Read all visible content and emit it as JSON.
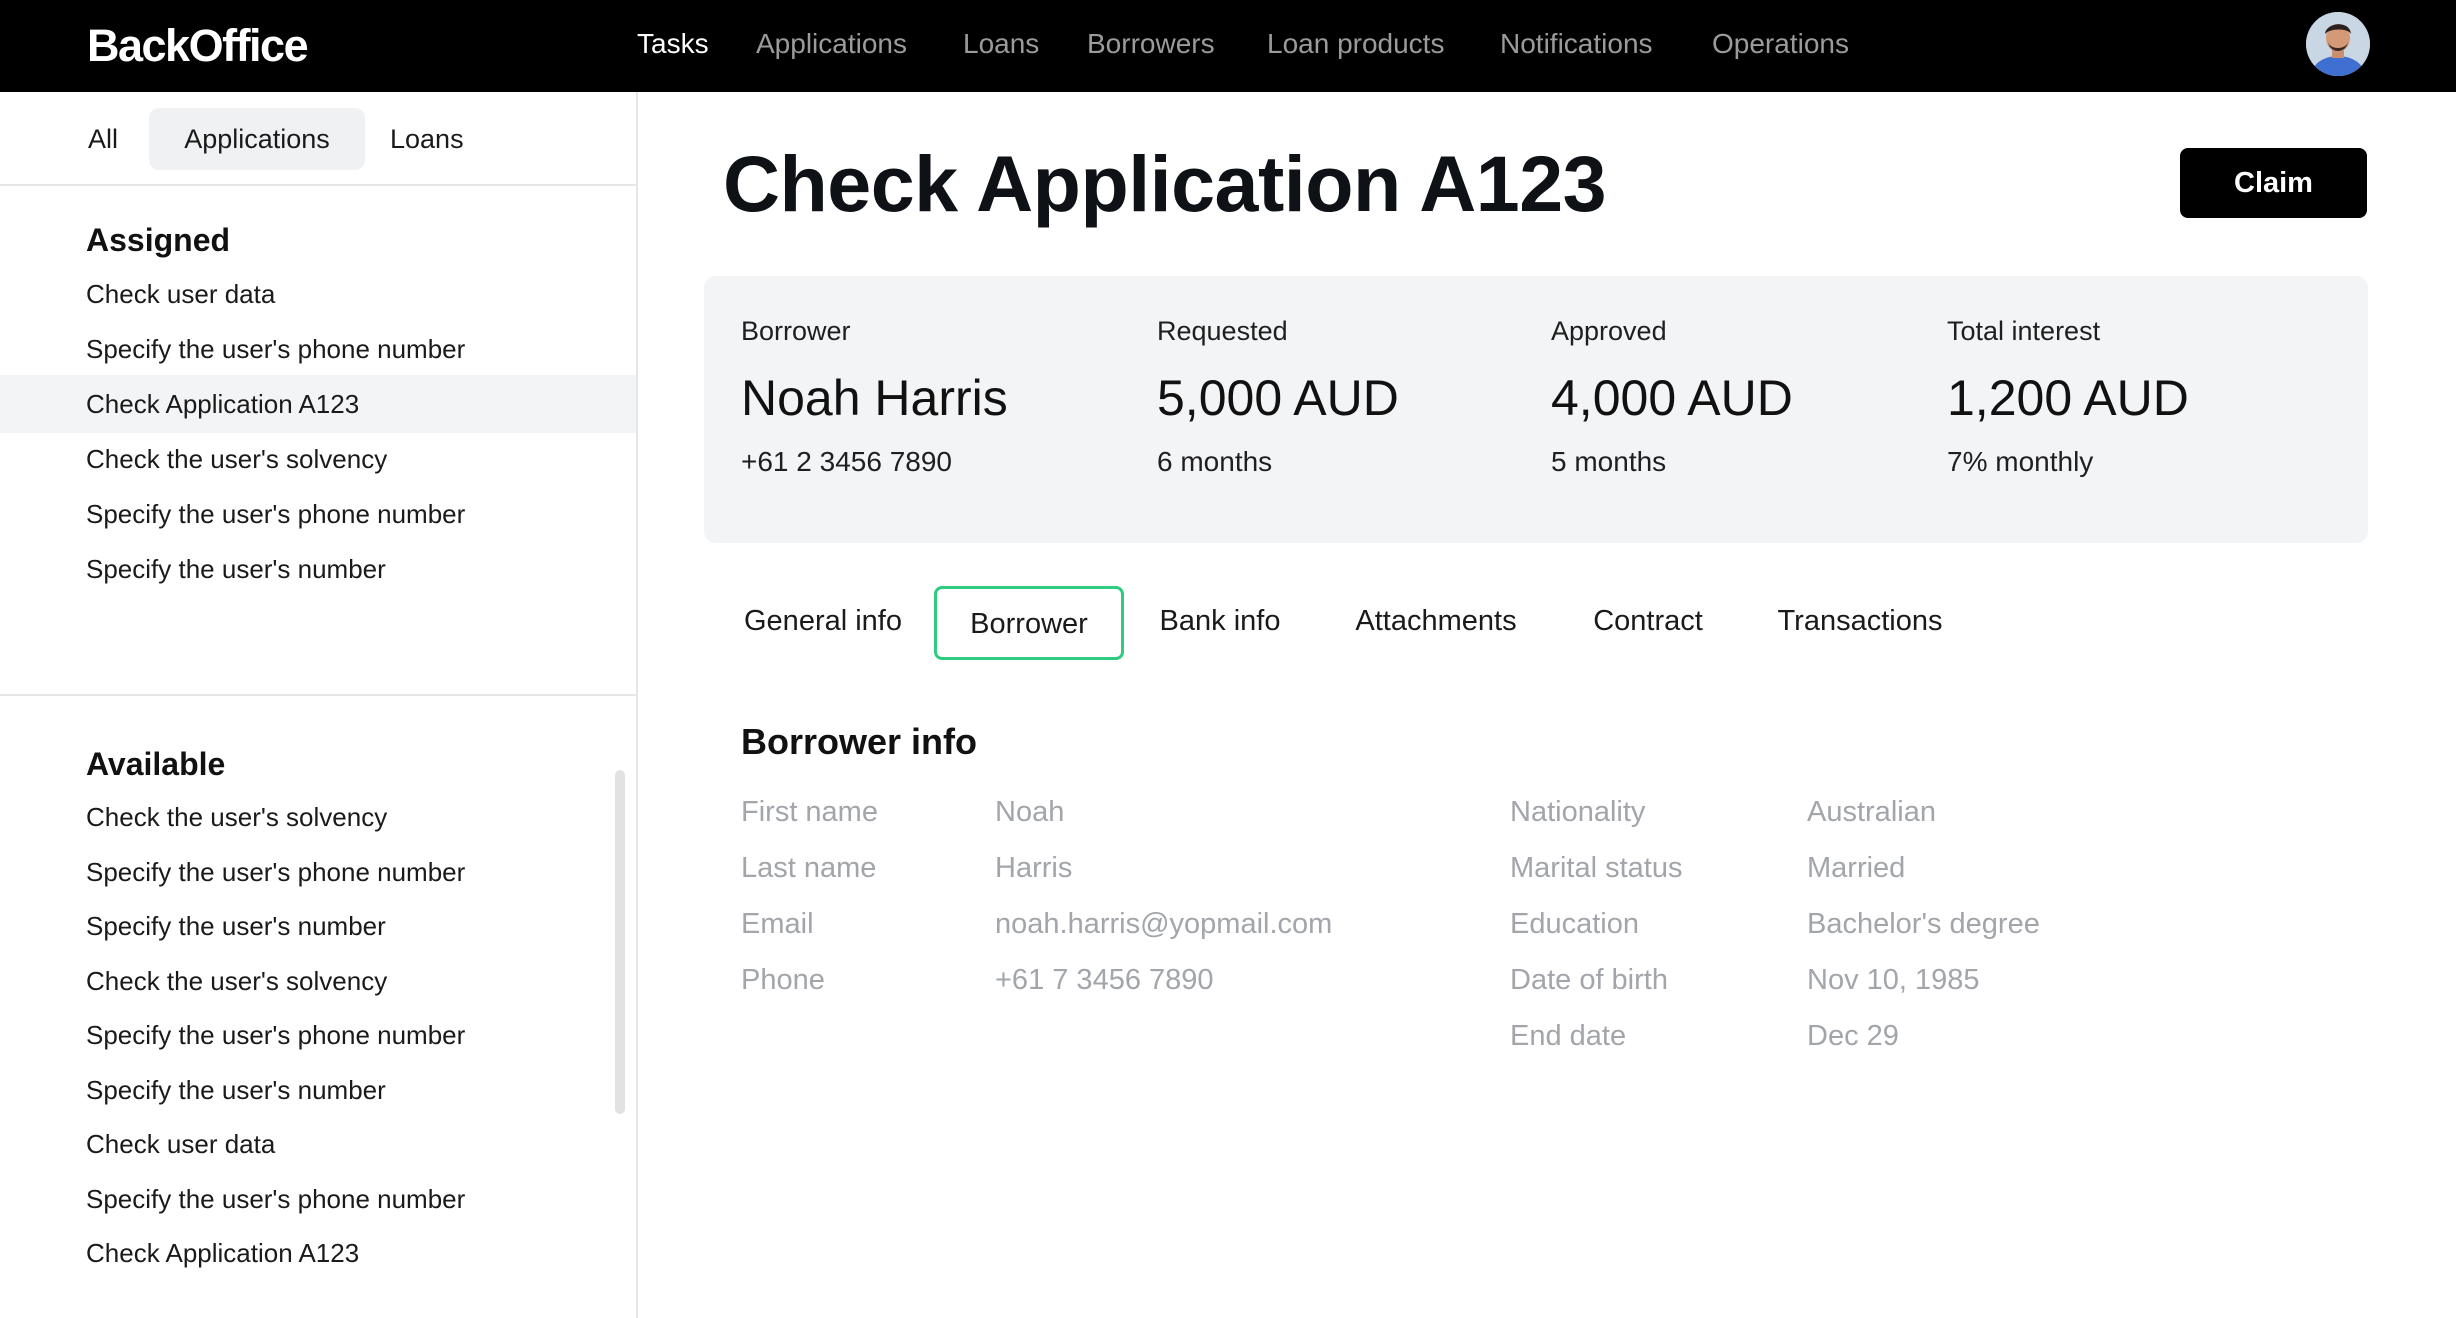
{
  "app": {
    "logo": "BackOffice"
  },
  "nav": {
    "items": [
      "Tasks",
      "Applications",
      "Loans",
      "Borrowers",
      "Loan products",
      "Notifications",
      "Operations"
    ],
    "active": "Tasks"
  },
  "sidebar": {
    "tabs": [
      "All",
      "Applications",
      "Loans"
    ],
    "active_tab": "Applications",
    "assigned": {
      "title": "Assigned",
      "items": [
        "Check user data",
        "Specify the user's phone number",
        "Check Application A123",
        "Check the user's solvency",
        "Specify the user's phone number",
        "Specify the user's number"
      ],
      "selected_index": 2
    },
    "available": {
      "title": "Available",
      "items": [
        "Check the user's solvency",
        "Specify the user's phone number",
        "Specify the user's number",
        "Check the user's solvency",
        "Specify the user's phone number",
        "Specify the user's number",
        "Check user data",
        "Specify the user's phone number",
        "Check Application A123"
      ]
    }
  },
  "main": {
    "title": "Check Application A123",
    "claim_label": "Claim",
    "summary": {
      "borrower": {
        "label": "Borrower",
        "value": "Noah Harris",
        "sub": "+61 2 3456 7890"
      },
      "requested": {
        "label": "Requested",
        "value": "5,000 AUD",
        "sub": "6 months"
      },
      "approved": {
        "label": "Approved",
        "value": "4,000 AUD",
        "sub": "5 months"
      },
      "interest": {
        "label": "Total interest",
        "value": "1,200 AUD",
        "sub": "7% monthly"
      }
    },
    "tabs": [
      "General info",
      "Borrower",
      "Bank info",
      "Attachments",
      "Contract",
      "Transactions"
    ],
    "active_tab": "Borrower",
    "borrower_info": {
      "title": "Borrower info",
      "left": [
        {
          "label": "First name",
          "value": "Noah"
        },
        {
          "label": "Last name",
          "value": "Harris"
        },
        {
          "label": "Email",
          "value": "noah.harris@yopmail.com"
        },
        {
          "label": "Phone",
          "value": "+61 7 3456 7890"
        }
      ],
      "right": [
        {
          "label": "Nationality",
          "value": "Australian"
        },
        {
          "label": "Marital status",
          "value": "Married"
        },
        {
          "label": "Education",
          "value": "Bachelor's degree"
        },
        {
          "label": "Date of birth",
          "value": "Nov 10, 1985"
        },
        {
          "label": "End date",
          "value": "Dec 29"
        }
      ]
    }
  },
  "colors": {
    "topbar": "#000000",
    "active_tab_border": "#2ecc7f",
    "summary_bg": "#f3f4f6",
    "muted_text": "#a2a5a9"
  }
}
